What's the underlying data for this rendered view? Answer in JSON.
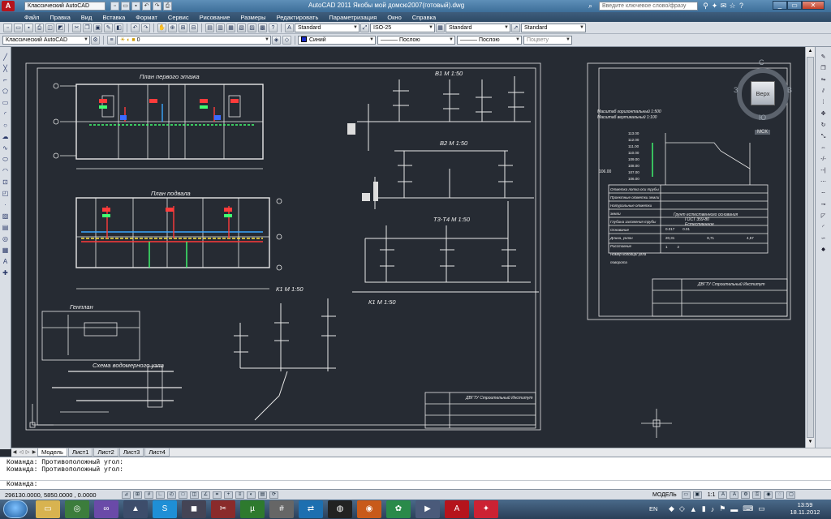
{
  "titlebar": {
    "workspace": "Классический AutoCAD",
    "title": "AutoCAD 2011    Якобы мой домсю2007(готовый).dwg",
    "search_placeholder": "Введите ключевое слово/фразу"
  },
  "menu": [
    "Файл",
    "Правка",
    "Вид",
    "Вставка",
    "Формат",
    "Сервис",
    "Рисование",
    "Размеры",
    "Редактировать",
    "Параметризация",
    "Окно",
    "Справка"
  ],
  "toolbar1": {
    "text_style": "Standard",
    "dim_style": "ISO-25",
    "table_style": "Standard",
    "multileader_style": "Standard"
  },
  "toolbar2": {
    "workspace": "Классический AutoCAD",
    "layer": "0",
    "color": "Синий",
    "linetype": "Послою",
    "lineweight": "Послою",
    "plotstyle": "Поцвету"
  },
  "drawing": {
    "plan_first_floor": "План первого этажа",
    "plan_basement": "План подвала",
    "genplan": "Генплан",
    "meter_scheme": "Схема водомерного узла",
    "b1": "В1  М 1:50",
    "b2": "В2  М 1:50",
    "t3t4": "Т3-Т4  М 1:50",
    "k1a": "К1  М 1:50",
    "k1b": "К1  М 1:50",
    "title_block_1": "ДВГТУ  Строительный Институт",
    "title_block_2": "ДВГТУ  Строительный Институт",
    "profile_scale_h": "Масштаб горизонтальный 1:500",
    "profile_scale_v": "Масштаб вертикальный 1:100",
    "profile_rows": [
      "Отметка лотка оси трубы",
      "Проектные отметки земли",
      "Натуральные отметки земли",
      "Глубина заложения трубы",
      "Основание",
      "Длина, уклон",
      "Расстояние",
      "Номер колодца/ угла поворота"
    ],
    "profile_soil": "Грунт естественного основания",
    "profile_gost": "ГОСТ 359-80",
    "profile_natural": "Естественное",
    "profile_levels": [
      "113.00",
      "112.00",
      "111.00",
      "110.00",
      "109.00",
      "108.00",
      "107.00",
      "106.00"
    ],
    "profile_base": "106.00",
    "profile_vals": [
      "0.017",
      "0.01",
      "20,31",
      "8,71",
      "4,57",
      "1",
      "2"
    ]
  },
  "viewcube": {
    "top": "Верх",
    "n": "С",
    "s": "Ю",
    "w": "З",
    "e": "В",
    "wcs": "МСК"
  },
  "tabs": [
    "Модель",
    "Лист1",
    "Лист2",
    "Лист3",
    "Лист4"
  ],
  "command": {
    "lines": [
      "Команда: Противоположный угол:",
      "Команда: Противоположный угол:"
    ],
    "prompt": "Команда:"
  },
  "status": {
    "coords": "296130.0000, 5850.0000 , 0.0000",
    "model": "МОДЕЛЬ",
    "scale": "1:1"
  },
  "taskbar": {
    "lang": "EN",
    "time": "13:59",
    "date": "18.11.2012"
  }
}
